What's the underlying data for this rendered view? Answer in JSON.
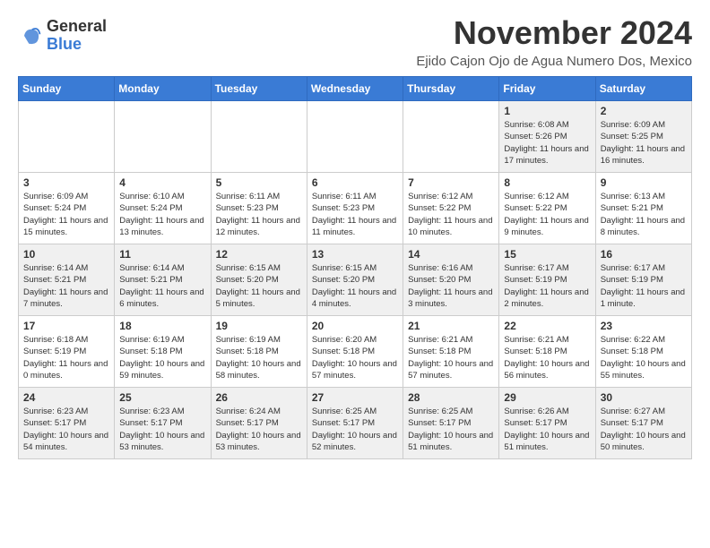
{
  "logo": {
    "general": "General",
    "blue": "Blue"
  },
  "header": {
    "month": "November 2024",
    "location": "Ejido Cajon Ojo de Agua Numero Dos, Mexico"
  },
  "weekdays": [
    "Sunday",
    "Monday",
    "Tuesday",
    "Wednesday",
    "Thursday",
    "Friday",
    "Saturday"
  ],
  "weeks": [
    [
      {
        "day": "",
        "info": ""
      },
      {
        "day": "",
        "info": ""
      },
      {
        "day": "",
        "info": ""
      },
      {
        "day": "",
        "info": ""
      },
      {
        "day": "",
        "info": ""
      },
      {
        "day": "1",
        "info": "Sunrise: 6:08 AM\nSunset: 5:26 PM\nDaylight: 11 hours and 17 minutes."
      },
      {
        "day": "2",
        "info": "Sunrise: 6:09 AM\nSunset: 5:25 PM\nDaylight: 11 hours and 16 minutes."
      }
    ],
    [
      {
        "day": "3",
        "info": "Sunrise: 6:09 AM\nSunset: 5:24 PM\nDaylight: 11 hours and 15 minutes."
      },
      {
        "day": "4",
        "info": "Sunrise: 6:10 AM\nSunset: 5:24 PM\nDaylight: 11 hours and 13 minutes."
      },
      {
        "day": "5",
        "info": "Sunrise: 6:11 AM\nSunset: 5:23 PM\nDaylight: 11 hours and 12 minutes."
      },
      {
        "day": "6",
        "info": "Sunrise: 6:11 AM\nSunset: 5:23 PM\nDaylight: 11 hours and 11 minutes."
      },
      {
        "day": "7",
        "info": "Sunrise: 6:12 AM\nSunset: 5:22 PM\nDaylight: 11 hours and 10 minutes."
      },
      {
        "day": "8",
        "info": "Sunrise: 6:12 AM\nSunset: 5:22 PM\nDaylight: 11 hours and 9 minutes."
      },
      {
        "day": "9",
        "info": "Sunrise: 6:13 AM\nSunset: 5:21 PM\nDaylight: 11 hours and 8 minutes."
      }
    ],
    [
      {
        "day": "10",
        "info": "Sunrise: 6:14 AM\nSunset: 5:21 PM\nDaylight: 11 hours and 7 minutes."
      },
      {
        "day": "11",
        "info": "Sunrise: 6:14 AM\nSunset: 5:21 PM\nDaylight: 11 hours and 6 minutes."
      },
      {
        "day": "12",
        "info": "Sunrise: 6:15 AM\nSunset: 5:20 PM\nDaylight: 11 hours and 5 minutes."
      },
      {
        "day": "13",
        "info": "Sunrise: 6:15 AM\nSunset: 5:20 PM\nDaylight: 11 hours and 4 minutes."
      },
      {
        "day": "14",
        "info": "Sunrise: 6:16 AM\nSunset: 5:20 PM\nDaylight: 11 hours and 3 minutes."
      },
      {
        "day": "15",
        "info": "Sunrise: 6:17 AM\nSunset: 5:19 PM\nDaylight: 11 hours and 2 minutes."
      },
      {
        "day": "16",
        "info": "Sunrise: 6:17 AM\nSunset: 5:19 PM\nDaylight: 11 hours and 1 minute."
      }
    ],
    [
      {
        "day": "17",
        "info": "Sunrise: 6:18 AM\nSunset: 5:19 PM\nDaylight: 11 hours and 0 minutes."
      },
      {
        "day": "18",
        "info": "Sunrise: 6:19 AM\nSunset: 5:18 PM\nDaylight: 10 hours and 59 minutes."
      },
      {
        "day": "19",
        "info": "Sunrise: 6:19 AM\nSunset: 5:18 PM\nDaylight: 10 hours and 58 minutes."
      },
      {
        "day": "20",
        "info": "Sunrise: 6:20 AM\nSunset: 5:18 PM\nDaylight: 10 hours and 57 minutes."
      },
      {
        "day": "21",
        "info": "Sunrise: 6:21 AM\nSunset: 5:18 PM\nDaylight: 10 hours and 57 minutes."
      },
      {
        "day": "22",
        "info": "Sunrise: 6:21 AM\nSunset: 5:18 PM\nDaylight: 10 hours and 56 minutes."
      },
      {
        "day": "23",
        "info": "Sunrise: 6:22 AM\nSunset: 5:18 PM\nDaylight: 10 hours and 55 minutes."
      }
    ],
    [
      {
        "day": "24",
        "info": "Sunrise: 6:23 AM\nSunset: 5:17 PM\nDaylight: 10 hours and 54 minutes."
      },
      {
        "day": "25",
        "info": "Sunrise: 6:23 AM\nSunset: 5:17 PM\nDaylight: 10 hours and 53 minutes."
      },
      {
        "day": "26",
        "info": "Sunrise: 6:24 AM\nSunset: 5:17 PM\nDaylight: 10 hours and 53 minutes."
      },
      {
        "day": "27",
        "info": "Sunrise: 6:25 AM\nSunset: 5:17 PM\nDaylight: 10 hours and 52 minutes."
      },
      {
        "day": "28",
        "info": "Sunrise: 6:25 AM\nSunset: 5:17 PM\nDaylight: 10 hours and 51 minutes."
      },
      {
        "day": "29",
        "info": "Sunrise: 6:26 AM\nSunset: 5:17 PM\nDaylight: 10 hours and 51 minutes."
      },
      {
        "day": "30",
        "info": "Sunrise: 6:27 AM\nSunset: 5:17 PM\nDaylight: 10 hours and 50 minutes."
      }
    ]
  ]
}
